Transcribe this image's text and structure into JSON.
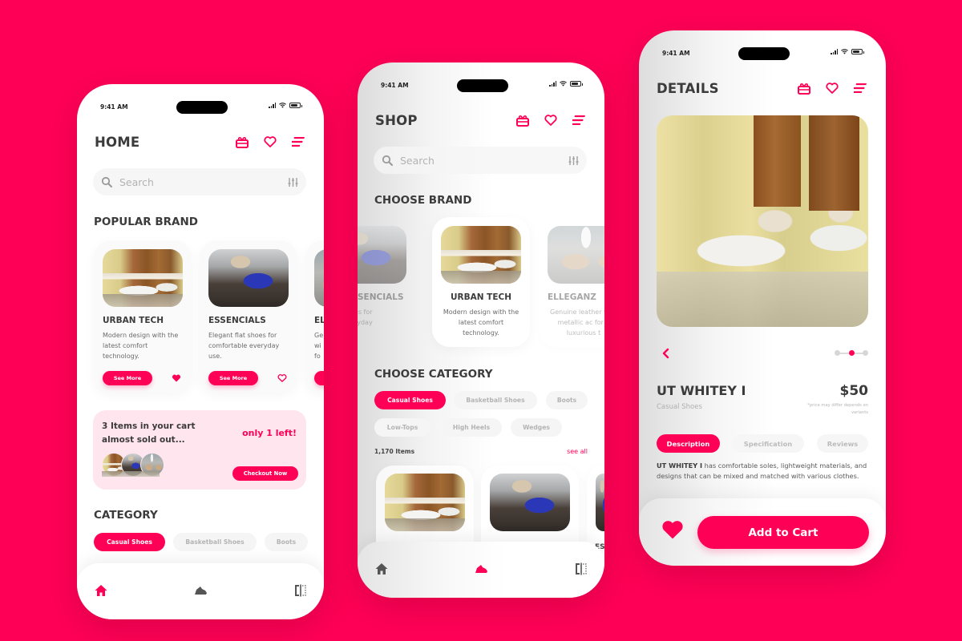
{
  "theme": {
    "accent": "#FF0057",
    "background": "#FF0057",
    "banner_bg": "#FFE5ED"
  },
  "status_bar": {
    "time": "9:41 AM"
  },
  "header_icons": [
    "gift-icon",
    "heart-icon",
    "menu-icon"
  ],
  "home": {
    "title": "HOME",
    "search": {
      "placeholder": "Search"
    },
    "popular_brand": {
      "title": "POPULAR BRAND",
      "cards": [
        {
          "name": "URBAN TECH",
          "description": "Modern design with the latest comfort technology.",
          "button": "See More",
          "favorited": true
        },
        {
          "name": "ESSENCIALS",
          "description": "Elegant flat shoes for comfortable everyday use.",
          "button": "See More",
          "favorited": false
        },
        {
          "name": "EL",
          "description": "Ge wi fo",
          "button": "See More",
          "favorited": false
        }
      ]
    },
    "cart_banner": {
      "message": "3 Items in your cart almost sold out...",
      "urgency": "only 1 left!",
      "button": "Checkout Now"
    },
    "category": {
      "title": "CATEGORY",
      "chips": [
        "Casual Shoes",
        "Basketball Shoes",
        "Boots"
      ],
      "active": "Casual Shoes"
    },
    "nav": {
      "items": [
        "home-icon",
        "sneaker-icon",
        "compare-icon"
      ],
      "active": "home-icon"
    }
  },
  "shop": {
    "title": "SHOP",
    "search": {
      "placeholder": "Search"
    },
    "choose_brand": {
      "title": "CHOOSE BRAND",
      "cards": [
        {
          "name": "SENCIALS",
          "description": "nt flat shoes for rtable everyday use."
        },
        {
          "name": "URBAN TECH",
          "description": "Modern design with the latest comfort technology."
        },
        {
          "name": "ELLEGANZ",
          "description": "Genuine leather with metallic ac for a luxurious t"
        }
      ]
    },
    "choose_category": {
      "title": "CHOOSE CATEGORY",
      "chips_row1": [
        "Casual Shoes",
        "Basketball Shoes",
        "Boots"
      ],
      "chips_row2": [
        "Low-Tops",
        "High Heels",
        "Wedges"
      ],
      "active": "Casual Shoes"
    },
    "items_count": "1,170 Items",
    "see_all": "see all",
    "partial_label": "ES",
    "nav": {
      "items": [
        "home-icon",
        "sneaker-icon",
        "compare-icon"
      ],
      "active": "sneaker-icon"
    }
  },
  "details": {
    "title": "DETAILS",
    "product": {
      "name": "UT WHITEY I",
      "category": "Casual Shoes",
      "price": "$50",
      "price_note": "*price may differ depends on variants"
    },
    "carousel": {
      "total": 3,
      "current": 2
    },
    "tabs": [
      "Description",
      "Specification",
      "Reviews"
    ],
    "active_tab": "Description",
    "description_lead": "UT WHITEY I",
    "description_rest": " has comfortable soles, lightweight materials, and designs that can be mixed and matched with various clothes.",
    "add_to_cart": "Add to Cart"
  }
}
